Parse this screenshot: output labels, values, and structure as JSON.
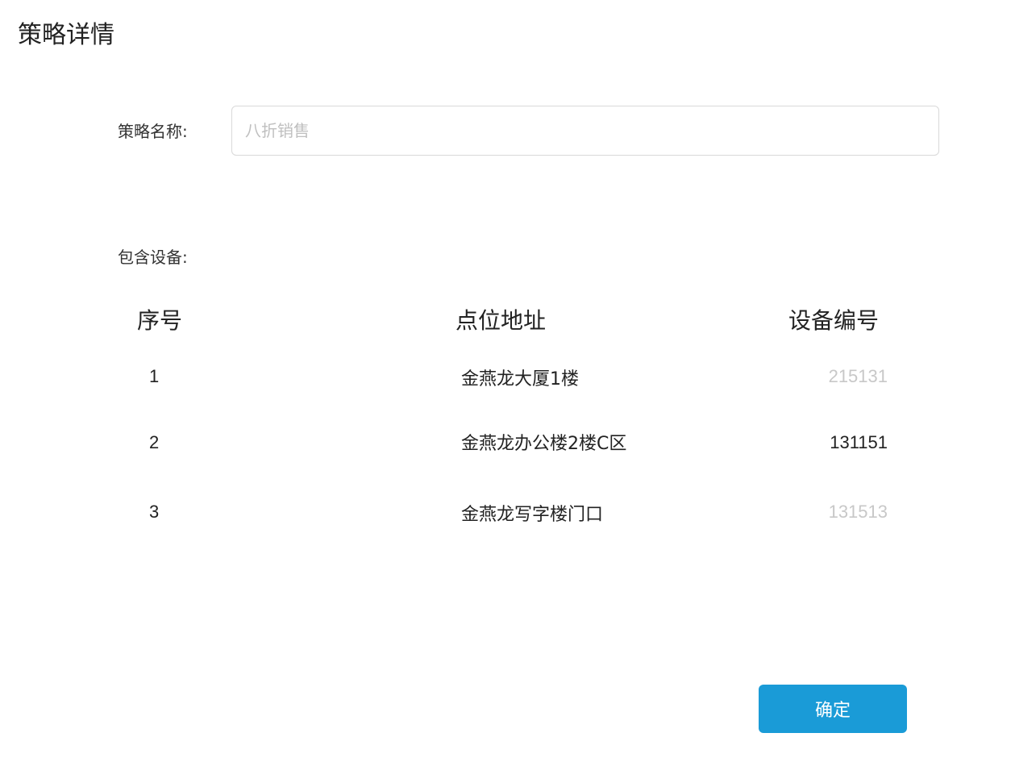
{
  "title": "策略详情",
  "form": {
    "name_label": "策略名称:",
    "name_placeholder": "八折销售",
    "name_value": "",
    "devices_label": "包含设备:"
  },
  "table": {
    "headers": {
      "index": "序号",
      "address": "点位地址",
      "device": "设备编号"
    },
    "rows": [
      {
        "index": "1",
        "address": "金燕龙大厦1楼",
        "device": "215131"
      },
      {
        "index": "2",
        "address": "金燕龙办公楼2楼C区",
        "device": "131151"
      },
      {
        "index": "3",
        "address": "金燕龙写字楼门口",
        "device": "131513"
      }
    ]
  },
  "actions": {
    "confirm_label": "确定"
  },
  "colors": {
    "primary": "#1a9bd7",
    "muted_text": "#c8c8c8"
  }
}
